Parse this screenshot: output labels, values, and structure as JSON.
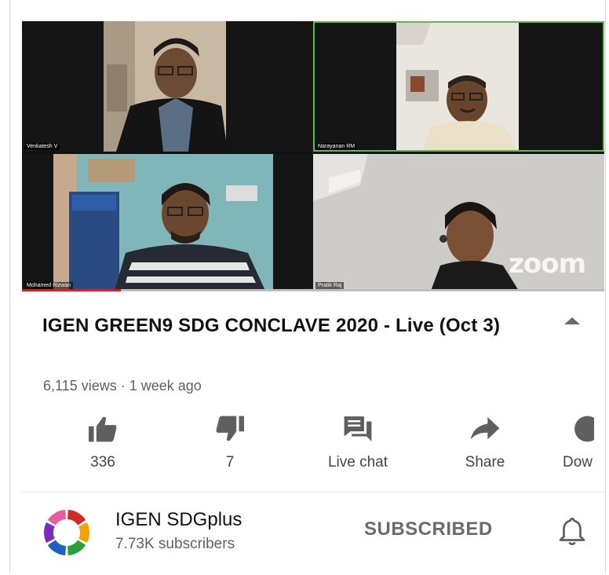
{
  "video": {
    "participants": [
      {
        "name": "Venkatesh V"
      },
      {
        "name": "Narayanan RM"
      },
      {
        "name": "Mohamed Rizwan"
      },
      {
        "name": "Pratik Raj"
      }
    ],
    "watermark": "zoom",
    "progress_fraction": 0.17
  },
  "details": {
    "title": "IGEN GREEN9 SDG CONCLAVE 2020 - Live (Oct 3)",
    "meta": "6,115 views · 1 week ago"
  },
  "actions": {
    "like": {
      "label": "336",
      "icon": "thumbs-up-icon"
    },
    "dislike": {
      "label": "7",
      "icon": "thumbs-down-icon"
    },
    "chat": {
      "label": "Live chat",
      "icon": "live-chat-icon"
    },
    "share": {
      "label": "Share",
      "icon": "share-icon"
    },
    "download": {
      "label": "Dow",
      "icon": "download-icon"
    }
  },
  "channel": {
    "name": "IGEN SDGplus",
    "subscribers": "7.73K subscribers",
    "subscribe_state": "SUBSCRIBED",
    "logo_colors": [
      "#d62828",
      "#f4a100",
      "#2b9e3e",
      "#1f5fbf",
      "#7b2cbf",
      "#e85d9b"
    ]
  },
  "colors": {
    "progress": "#e21b1b",
    "active_speaker": "#57c13a"
  }
}
